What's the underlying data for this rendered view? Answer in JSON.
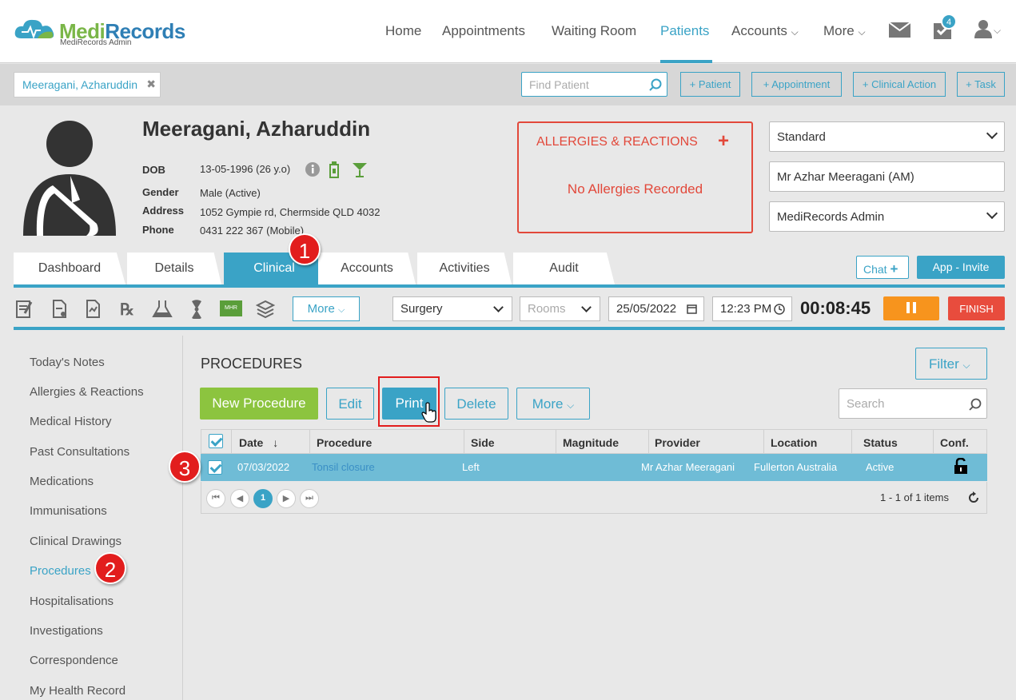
{
  "brand": {
    "name_part1": "Medi",
    "name_part2": "Records",
    "subtitle": "MediRecords Admin"
  },
  "nav": {
    "items": [
      "Home",
      "Appointments",
      "Waiting Room",
      "Patients",
      "Accounts",
      "More"
    ],
    "active": "Patients",
    "task_badge": "4"
  },
  "bar2": {
    "patient_chip": "Meeragani, Azharuddin",
    "find_placeholder": "Find Patient",
    "buttons": [
      "+ Patient",
      "+ Appointment",
      "+ Clinical Action",
      "+ Task"
    ]
  },
  "patient": {
    "name": "Meeragani, Azharuddin",
    "dob_label": "DOB",
    "dob": "13-05-1996 (26 y.o)",
    "gender_label": "Gender",
    "gender": "Male (Active)",
    "address_label": "Address",
    "address": "1052 Gympie rd, Chermside QLD 4032",
    "phone_label": "Phone",
    "phone": "0431 222 367 (Mobile)"
  },
  "allergies": {
    "title": "ALLERGIES & REACTIONS",
    "plus": "+",
    "status": "No Allergies Recorded"
  },
  "right_selects": {
    "type": "Standard",
    "practitioner": "Mr Azhar Meeragani (AM)",
    "org": "MediRecords Admin"
  },
  "tabs": [
    "Dashboard",
    "Details",
    "Clinical",
    "Accounts",
    "Activities",
    "Audit"
  ],
  "active_tab": "Clinical",
  "chat_label": "Chat",
  "app_invite_label": "App - Invite",
  "toolbar": {
    "more_label": "More",
    "location": "Surgery",
    "rooms_placeholder": "Rooms",
    "date": "25/05/2022",
    "time": "12:23 PM",
    "timer": "00:08:45",
    "finish_label": "FINISH",
    "mhr_label": "MHR"
  },
  "sidebar": {
    "items": [
      "Today's Notes",
      "Allergies & Reactions",
      "Medical History",
      "Past Consultations",
      "Medications",
      "Immunisations",
      "Clinical Drawings",
      "Procedures",
      "Hospitalisations",
      "Investigations",
      "Correspondence",
      "My Health Record"
    ],
    "active": "Procedures"
  },
  "procedures": {
    "title": "PROCEDURES",
    "filter_label": "Filter",
    "buttons": {
      "new": "New Procedure",
      "edit": "Edit",
      "print": "Print",
      "delete": "Delete",
      "more": "More"
    },
    "search_placeholder": "Search",
    "columns": [
      "Date",
      "Procedure",
      "Side",
      "Magnitude",
      "Provider",
      "Location",
      "Status",
      "Conf."
    ],
    "rows": [
      {
        "date": "07/03/2022",
        "procedure": "Tonsil closure",
        "side": "Left",
        "magnitude": "",
        "provider": "Mr Azhar Meeragani",
        "location": "Fullerton Australia",
        "status": "Active"
      }
    ],
    "page": "1",
    "items_text": "1 - 1 of 1 items"
  },
  "markers": [
    "1",
    "2",
    "3"
  ],
  "colors": {
    "accent": "#3aa3c6",
    "green": "#8cc43f",
    "alert": "#e2483a",
    "pause": "#f7941d",
    "finish": "#e84c3d"
  }
}
